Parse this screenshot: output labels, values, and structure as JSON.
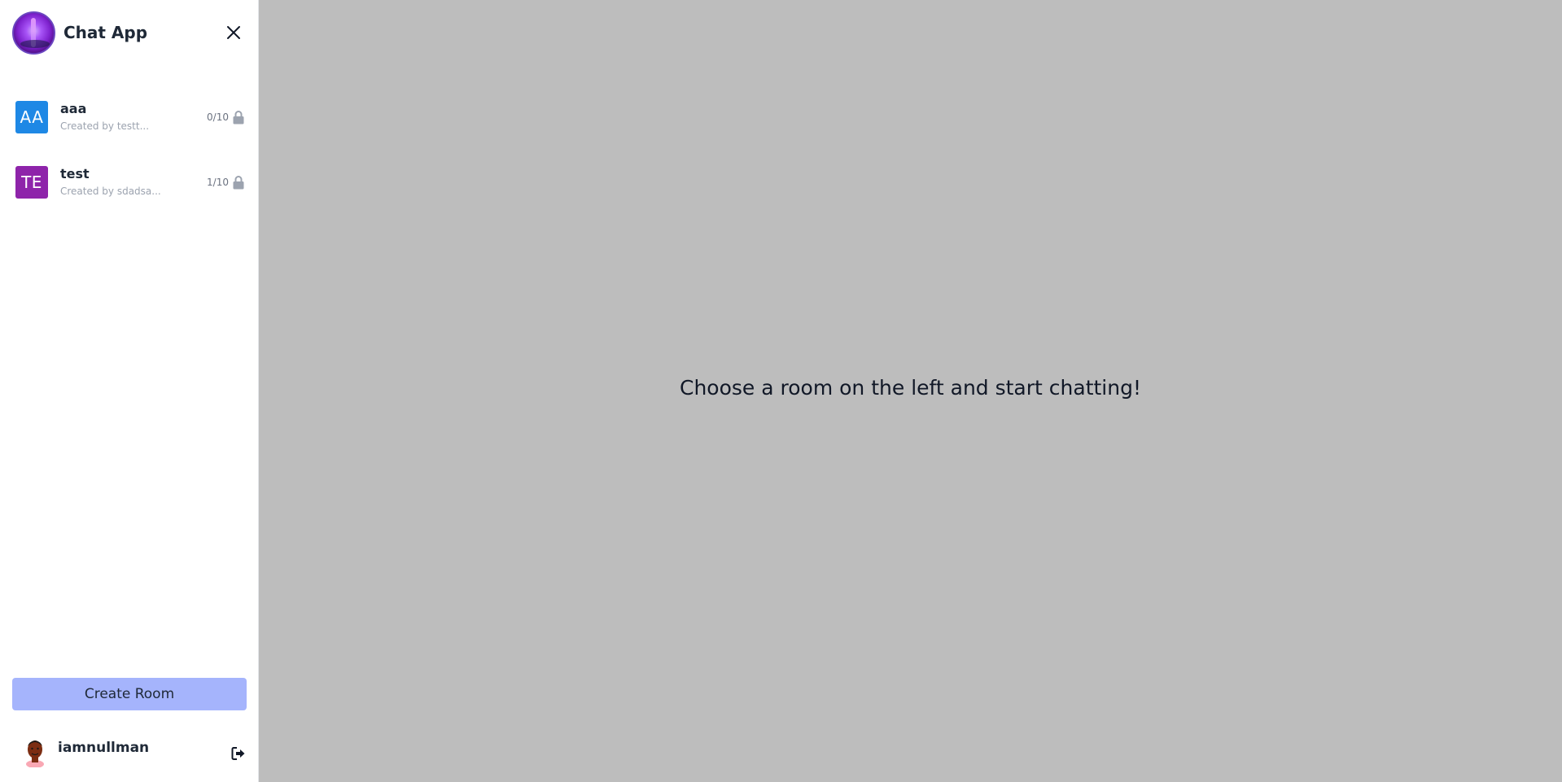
{
  "app": {
    "title": "Chat App"
  },
  "rooms": [
    {
      "initials": "AA",
      "name": "aaa",
      "created_by": "Created by testt...",
      "occupancy": "0/10",
      "color": "#1e88e5",
      "icon": "lock-icon"
    },
    {
      "initials": "TE",
      "name": "test",
      "created_by": "Created by sdadsa...",
      "occupancy": "1/10",
      "color": "#8e24aa",
      "icon": "lock-icon"
    }
  ],
  "sidebar": {
    "create_room_label": "Create Room",
    "close_icon": "close-icon"
  },
  "user": {
    "username": "iamnullman",
    "logout_icon": "logout-icon"
  },
  "main": {
    "placeholder": "Choose a room on the left and start chatting!",
    "background": "#bdbdbd"
  },
  "colors": {
    "accent": "#a5b4fc",
    "text": "#1f2937",
    "muted": "#9ca3af"
  }
}
